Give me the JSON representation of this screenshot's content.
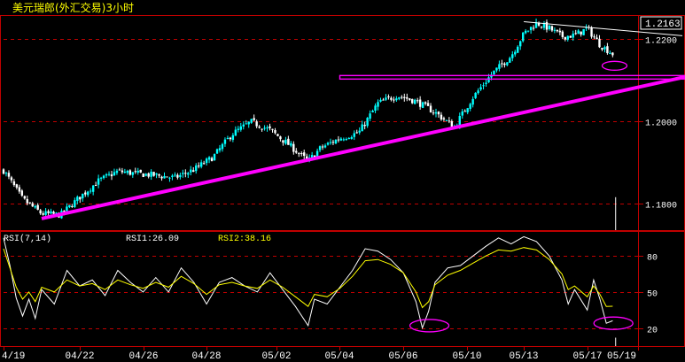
{
  "colors": {
    "background": "#000000",
    "frame": "#c00000",
    "grid": "#c00000",
    "candle_up": "#00ffff",
    "candle_down": "#ffffff",
    "trendline": "#ff00ff",
    "resistance_box": "#ff00ff",
    "rsi_fast": "#ffffff",
    "rsi_slow": "#ffff00",
    "price_tag_bg": "#000000",
    "price_tag_border": "#ffffff",
    "header_text": "#ffff00",
    "axis_text": "#ffffff"
  },
  "chart_data": [
    {
      "type": "candlestick",
      "title": "美元瑞郎(外汇交易)3小时",
      "last_price_tag": "1.2163",
      "y_ticks": [
        "1.2200",
        "1.2000",
        "1.1800"
      ],
      "ylim": [
        1.1735,
        1.2255
      ],
      "x_ticks": [
        "4/19",
        "04/22",
        "04/26",
        "04/28",
        "05/02",
        "05/04",
        "05/06",
        "05/10",
        "05/13",
        "05/17",
        "05/19"
      ],
      "grid": true,
      "close_path": [
        [
          0,
          1.188
        ],
        [
          3,
          1.181
        ],
        [
          6,
          1.1775
        ],
        [
          9,
          1.1772
        ],
        [
          12,
          1.1815
        ],
        [
          15,
          1.1855
        ],
        [
          18,
          1.1878
        ],
        [
          21,
          1.1872
        ],
        [
          24,
          1.1868
        ],
        [
          27,
          1.1862
        ],
        [
          30,
          1.1882
        ],
        [
          33,
          1.1912
        ],
        [
          36,
          1.1968
        ],
        [
          39,
          1.1998
        ],
        [
          42,
          1.1978
        ],
        [
          45,
          1.1942
        ],
        [
          48,
          1.1902
        ],
        [
          50,
          1.1935
        ],
        [
          53,
          1.1958
        ],
        [
          56,
          1.1972
        ],
        [
          59,
          1.2043
        ],
        [
          62,
          1.2062
        ],
        [
          65,
          1.2048
        ],
        [
          68,
          1.2021
        ],
        [
          71,
          1.1985
        ],
        [
          74,
          1.2058
        ],
        [
          77,
          1.2115
        ],
        [
          80,
          1.2158
        ],
        [
          82,
          1.2212
        ],
        [
          84,
          1.2238
        ],
        [
          86,
          1.2225
        ],
        [
          88,
          1.2205
        ],
        [
          90,
          1.2208
        ],
        [
          92,
          1.2225
        ],
        [
          94,
          1.2185
        ],
        [
          96,
          1.2163
        ]
      ],
      "annotations": {
        "support_trendline": [
          [
            6,
            1.1763
          ],
          [
            100,
            1.2078
          ]
        ],
        "resistance_line": [
          [
            53,
            1.2106
          ],
          [
            100,
            1.2106
          ]
        ],
        "top_trendline": [
          [
            82,
            1.2241
          ],
          [
            100,
            1.2207
          ]
        ]
      }
    },
    {
      "type": "line",
      "title": "RSI(7,14)",
      "labels": [
        "RSI1:26.09",
        "RSI2:38.16"
      ],
      "y_ticks": [
        "80",
        "50",
        "20"
      ],
      "ylim": [
        5,
        100
      ],
      "x_ticks": [
        "4/19",
        "04/22",
        "04/26",
        "04/28",
        "05/02",
        "05/04",
        "05/06",
        "05/10",
        "05/13",
        "05/17",
        "05/19"
      ],
      "series": [
        {
          "name": "RSI1",
          "points": [
            [
              0,
              95
            ],
            [
              1,
              72
            ],
            [
              2,
              45
            ],
            [
              3,
              30
            ],
            [
              4,
              44
            ],
            [
              5,
              28
            ],
            [
              6,
              52
            ],
            [
              8,
              40
            ],
            [
              10,
              68
            ],
            [
              12,
              55
            ],
            [
              14,
              60
            ],
            [
              16,
              47
            ],
            [
              18,
              68
            ],
            [
              20,
              58
            ],
            [
              22,
              50
            ],
            [
              24,
              62
            ],
            [
              26,
              50
            ],
            [
              28,
              70
            ],
            [
              30,
              58
            ],
            [
              32,
              40
            ],
            [
              34,
              58
            ],
            [
              36,
              62
            ],
            [
              38,
              55
            ],
            [
              40,
              50
            ],
            [
              42,
              66
            ],
            [
              44,
              52
            ],
            [
              46,
              38
            ],
            [
              48,
              22
            ],
            [
              49,
              44
            ],
            [
              51,
              40
            ],
            [
              53,
              54
            ],
            [
              55,
              68
            ],
            [
              57,
              86
            ],
            [
              59,
              84
            ],
            [
              61,
              77
            ],
            [
              63,
              66
            ],
            [
              65,
              42
            ],
            [
              66,
              20
            ],
            [
              67,
              34
            ],
            [
              68,
              58
            ],
            [
              70,
              70
            ],
            [
              72,
              72
            ],
            [
              74,
              80
            ],
            [
              76,
              88
            ],
            [
              78,
              95
            ],
            [
              80,
              90
            ],
            [
              82,
              96
            ],
            [
              84,
              92
            ],
            [
              86,
              80
            ],
            [
              88,
              60
            ],
            [
              89,
              40
            ],
            [
              90,
              52
            ],
            [
              92,
              35
            ],
            [
              93,
              60
            ],
            [
              94,
              44
            ],
            [
              95,
              24
            ],
            [
              96,
              26.09
            ]
          ]
        },
        {
          "name": "RSI2",
          "points": [
            [
              0,
              86
            ],
            [
              1,
              70
            ],
            [
              2,
              54
            ],
            [
              3,
              44
            ],
            [
              4,
              50
            ],
            [
              5,
              42
            ],
            [
              6,
              54
            ],
            [
              8,
              50
            ],
            [
              10,
              60
            ],
            [
              12,
              55
            ],
            [
              14,
              57
            ],
            [
              16,
              52
            ],
            [
              18,
              60
            ],
            [
              20,
              56
            ],
            [
              22,
              53
            ],
            [
              24,
              58
            ],
            [
              26,
              54
            ],
            [
              28,
              63
            ],
            [
              30,
              57
            ],
            [
              32,
              48
            ],
            [
              34,
              56
            ],
            [
              36,
              58
            ],
            [
              38,
              55
            ],
            [
              40,
              53
            ],
            [
              42,
              60
            ],
            [
              44,
              54
            ],
            [
              46,
              46
            ],
            [
              48,
              38
            ],
            [
              49,
              48
            ],
            [
              51,
              46
            ],
            [
              53,
              53
            ],
            [
              55,
              63
            ],
            [
              57,
              76
            ],
            [
              59,
              77
            ],
            [
              61,
              73
            ],
            [
              63,
              66
            ],
            [
              65,
              50
            ],
            [
              66,
              37
            ],
            [
              67,
              42
            ],
            [
              68,
              56
            ],
            [
              70,
              64
            ],
            [
              72,
              68
            ],
            [
              74,
              74
            ],
            [
              76,
              80
            ],
            [
              78,
              85
            ],
            [
              80,
              84
            ],
            [
              82,
              87
            ],
            [
              84,
              85
            ],
            [
              86,
              77
            ],
            [
              88,
              65
            ],
            [
              89,
              52
            ],
            [
              90,
              55
            ],
            [
              92,
              46
            ],
            [
              93,
              55
            ],
            [
              94,
              48
            ],
            [
              95,
              38
            ],
            [
              96,
              38.16
            ]
          ]
        }
      ],
      "annotations": {
        "ellipses_at": [
          [
            66,
            22
          ],
          [
            95,
            24
          ]
        ]
      }
    }
  ]
}
